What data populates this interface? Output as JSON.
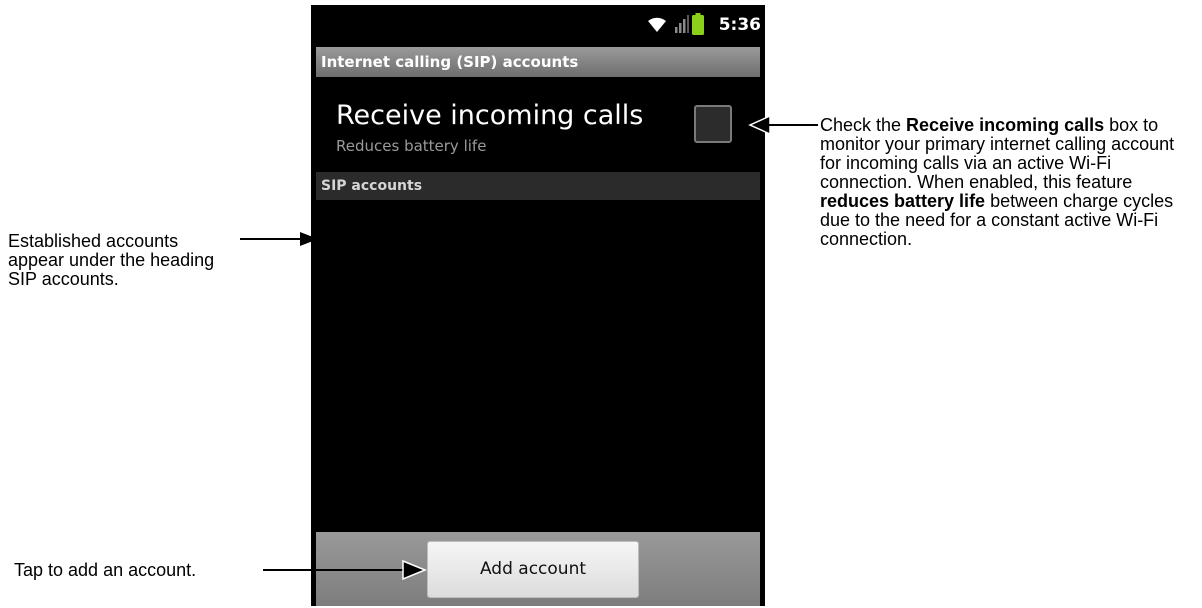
{
  "status_bar": {
    "time": "5:36",
    "icons": [
      "wifi-icon",
      "signal-icon",
      "battery-icon"
    ],
    "battery_color": "#8bd11b"
  },
  "screen": {
    "title": "Internet calling (SIP) accounts",
    "receive_calls": {
      "title": "Receive incoming calls",
      "summary": "Reduces battery life",
      "checked": false
    },
    "section_header": "SIP accounts",
    "add_account_label": "Add account"
  },
  "annotations": {
    "sip_list": "Established accounts appear under the heading SIP accounts.",
    "add_button": "Tap to add an account.",
    "checkbox": {
      "t1": "Check the ",
      "b1": "Receive incoming calls",
      "t2": " box to monitor your primary internet calling account for incoming calls via an active Wi-Fi connection. When enabled, this feature ",
      "b2": "reduces battery life",
      "t3": " between charge cycles due to the need for a constant active Wi-Fi connection."
    }
  }
}
